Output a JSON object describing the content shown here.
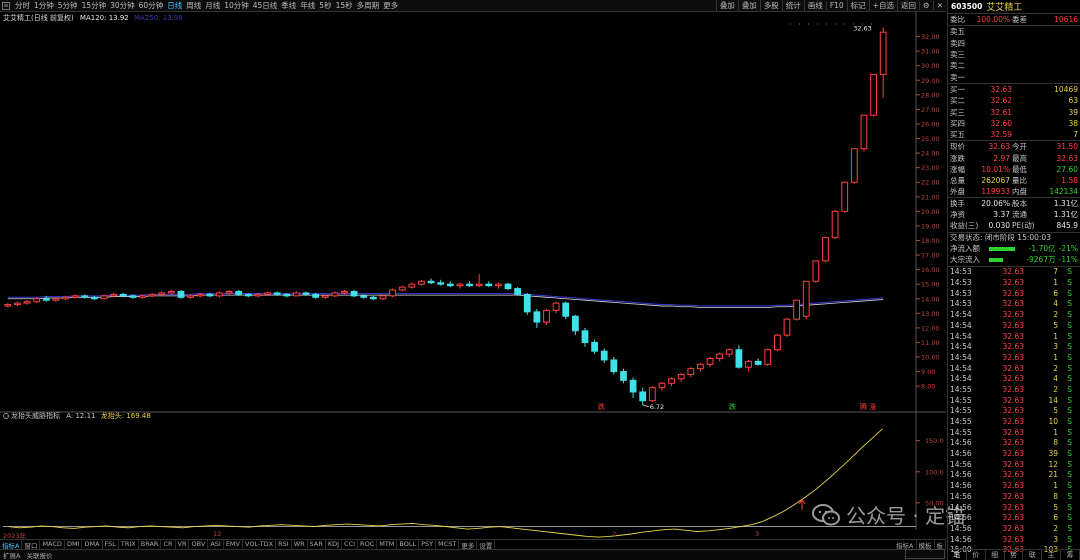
{
  "toolbar": {
    "periods": [
      "分时",
      "1分钟",
      "5分钟",
      "15分钟",
      "30分钟",
      "60分钟",
      "日线",
      "周线",
      "月线",
      "10分钟",
      "45日线",
      "季线",
      "年线",
      "5秒",
      "15秒",
      "多周期",
      "更多"
    ],
    "active_period": "日线",
    "tools": [
      "叠加",
      "叠加",
      "多股",
      "统计",
      "画线",
      "F10",
      "标记",
      "+自选",
      "返回"
    ]
  },
  "chart": {
    "stock_name": "艾艾精工",
    "stock_mode": "(日线 前复权)",
    "ma_label": "MA120: 13.92",
    "ma_dark": "MA250: 13.98",
    "high_label": "32.63",
    "low_label": "6.72",
    "price_ticks": [
      "32.00",
      "31.00",
      "30.00",
      "29.00",
      "28.00",
      "27.00",
      "26.00",
      "25.00",
      "24.00",
      "23.00",
      "22.00",
      "21.00",
      "20.00",
      "19.00",
      "18.00",
      "17.00",
      "16.00",
      "15.00",
      "14.00",
      "13.00",
      "12.00",
      "11.00",
      "10.00",
      "9.00",
      "8.00"
    ],
    "marks": [
      {
        "text": "跌",
        "color": "#ff4040"
      },
      {
        "text": "跌",
        "color": "#2fd22f"
      },
      {
        "text": "腾 涨",
        "color": "#ff4040"
      }
    ]
  },
  "chart_data": {
    "type": "candlestick",
    "ylim": [
      6.5,
      33
    ],
    "ohlc": [
      [
        13.5,
        13.7,
        13.4,
        13.6
      ],
      [
        13.6,
        13.8,
        13.5,
        13.7
      ],
      [
        13.7,
        13.9,
        13.6,
        13.8
      ],
      [
        13.8,
        14.1,
        13.7,
        14.0
      ],
      [
        14.0,
        14.2,
        13.8,
        13.9
      ],
      [
        13.9,
        14.1,
        13.8,
        14.0
      ],
      [
        14.0,
        14.2,
        13.9,
        14.1
      ],
      [
        14.1,
        14.3,
        14.0,
        14.2
      ],
      [
        14.2,
        14.3,
        14.0,
        14.1
      ],
      [
        14.1,
        14.2,
        13.9,
        14.0
      ],
      [
        14.0,
        14.3,
        14.0,
        14.2
      ],
      [
        14.2,
        14.4,
        14.1,
        14.3
      ],
      [
        14.3,
        14.4,
        14.1,
        14.2
      ],
      [
        14.2,
        14.3,
        14.0,
        14.1
      ],
      [
        14.1,
        14.3,
        14.0,
        14.2
      ],
      [
        14.2,
        14.4,
        14.1,
        14.3
      ],
      [
        14.3,
        14.5,
        14.2,
        14.4
      ],
      [
        14.4,
        14.6,
        14.3,
        14.5
      ],
      [
        14.5,
        14.6,
        14.0,
        14.1
      ],
      [
        14.1,
        14.3,
        14.0,
        14.2
      ],
      [
        14.2,
        14.4,
        14.1,
        14.3
      ],
      [
        14.3,
        14.4,
        14.1,
        14.2
      ],
      [
        14.2,
        14.5,
        14.1,
        14.4
      ],
      [
        14.4,
        14.6,
        14.3,
        14.5
      ],
      [
        14.5,
        14.6,
        14.2,
        14.3
      ],
      [
        14.3,
        14.4,
        14.1,
        14.2
      ],
      [
        14.2,
        14.4,
        14.1,
        14.3
      ],
      [
        14.3,
        14.5,
        14.2,
        14.4
      ],
      [
        14.4,
        14.5,
        14.2,
        14.3
      ],
      [
        14.3,
        14.4,
        14.1,
        14.2
      ],
      [
        14.2,
        14.5,
        14.2,
        14.4
      ],
      [
        14.4,
        14.5,
        14.2,
        14.3
      ],
      [
        14.3,
        14.4,
        14.0,
        14.1
      ],
      [
        14.1,
        14.3,
        14.0,
        14.2
      ],
      [
        14.2,
        14.5,
        14.1,
        14.4
      ],
      [
        14.4,
        14.6,
        14.3,
        14.5
      ],
      [
        14.5,
        14.6,
        14.1,
        14.2
      ],
      [
        14.2,
        14.3,
        14.0,
        14.1
      ],
      [
        14.1,
        14.2,
        13.9,
        14.0
      ],
      [
        14.0,
        14.3,
        13.9,
        14.2
      ],
      [
        14.2,
        14.7,
        14.1,
        14.6
      ],
      [
        14.6,
        14.9,
        14.5,
        14.8
      ],
      [
        14.8,
        15.1,
        14.7,
        15.0
      ],
      [
        15.0,
        15.3,
        14.9,
        15.2
      ],
      [
        15.2,
        15.4,
        15.0,
        15.1
      ],
      [
        15.1,
        15.3,
        14.9,
        15.0
      ],
      [
        15.0,
        15.2,
        14.8,
        14.9
      ],
      [
        14.9,
        15.1,
        14.7,
        15.0
      ],
      [
        15.0,
        15.2,
        14.8,
        14.9
      ],
      [
        14.9,
        15.7,
        14.8,
        15.0
      ],
      [
        15.0,
        15.2,
        14.8,
        14.9
      ],
      [
        14.9,
        15.1,
        14.7,
        15.0
      ],
      [
        15.0,
        15.1,
        14.6,
        14.7
      ],
      [
        14.7,
        14.8,
        14.2,
        14.3
      ],
      [
        14.3,
        14.4,
        12.9,
        13.1
      ],
      [
        13.1,
        13.3,
        12.0,
        12.4
      ],
      [
        12.4,
        13.3,
        12.2,
        13.2
      ],
      [
        13.2,
        13.8,
        13.0,
        13.7
      ],
      [
        13.7,
        13.8,
        12.6,
        12.8
      ],
      [
        12.8,
        12.9,
        11.5,
        11.8
      ],
      [
        11.8,
        12.0,
        10.7,
        11.0
      ],
      [
        11.0,
        11.2,
        10.2,
        10.4
      ],
      [
        10.4,
        10.6,
        9.6,
        9.8
      ],
      [
        9.8,
        10.0,
        8.8,
        9.0
      ],
      [
        9.0,
        9.2,
        8.2,
        8.4
      ],
      [
        8.4,
        8.6,
        7.2,
        7.6
      ],
      [
        7.6,
        7.9,
        6.72,
        7.0
      ],
      [
        7.0,
        8.0,
        6.9,
        7.9
      ],
      [
        7.9,
        8.3,
        7.7,
        8.2
      ],
      [
        8.2,
        8.6,
        8.0,
        8.5
      ],
      [
        8.5,
        8.9,
        8.3,
        8.8
      ],
      [
        8.8,
        9.3,
        8.6,
        9.2
      ],
      [
        9.2,
        9.6,
        9.0,
        9.5
      ],
      [
        9.5,
        10.0,
        9.3,
        9.9
      ],
      [
        9.9,
        10.3,
        9.7,
        10.2
      ],
      [
        10.2,
        10.6,
        10.0,
        10.5
      ],
      [
        10.5,
        10.8,
        9.2,
        9.3
      ],
      [
        9.3,
        9.8,
        9.0,
        9.7
      ],
      [
        9.7,
        9.9,
        9.4,
        9.5
      ],
      [
        9.5,
        10.6,
        9.4,
        10.5
      ],
      [
        10.5,
        11.6,
        10.4,
        11.5
      ],
      [
        11.5,
        12.7,
        11.4,
        12.6
      ],
      [
        12.6,
        13.9,
        12.5,
        13.9
      ],
      [
        12.8,
        15.2,
        12.6,
        15.2
      ],
      [
        15.2,
        16.6,
        15.1,
        16.6
      ],
      [
        16.6,
        18.2,
        16.5,
        18.2
      ],
      [
        18.2,
        20.1,
        18.1,
        20.0
      ],
      [
        20.0,
        22.0,
        19.9,
        22.0
      ],
      [
        22.0,
        24.3,
        21.9,
        24.3
      ],
      [
        24.3,
        26.6,
        24.1,
        26.6
      ],
      [
        26.6,
        29.4,
        26.5,
        29.4
      ],
      [
        29.4,
        32.63,
        27.8,
        32.3
      ]
    ],
    "ma": [
      14.0,
      14.0,
      14.0,
      14.0,
      14.05,
      14.05,
      14.05,
      14.1,
      14.1,
      14.1,
      14.1,
      14.15,
      14.15,
      14.15,
      14.15,
      14.2,
      14.2,
      14.2,
      14.2,
      14.2,
      14.25,
      14.25,
      14.25,
      14.25,
      14.25,
      14.25,
      14.25,
      14.25,
      14.25,
      14.25,
      14.25,
      14.25,
      14.25,
      14.25,
      14.25,
      14.25,
      14.25,
      14.25,
      14.25,
      14.25,
      14.25,
      14.25,
      14.25,
      14.25,
      14.25,
      14.25,
      14.25,
      14.25,
      14.25,
      14.25,
      14.25,
      14.25,
      14.25,
      14.25,
      14.2,
      14.15,
      14.1,
      14.05,
      14.0,
      13.95,
      13.9,
      13.85,
      13.8,
      13.75,
      13.7,
      13.65,
      13.6,
      13.55,
      13.5,
      13.5,
      13.45,
      13.45,
      13.4,
      13.4,
      13.4,
      13.4,
      13.4,
      13.4,
      13.4,
      13.4,
      13.45,
      13.45,
      13.5,
      13.55,
      13.6,
      13.65,
      13.7,
      13.75,
      13.8,
      13.85,
      13.9,
      13.95
    ],
    "indicator": {
      "name": "龙抬头威胁指标",
      "a_label": "A: 12.11",
      "b_label": "龙抬头: 169.48",
      "ylim": [
        0,
        180
      ],
      "ticks": [
        "150.0",
        "100.0",
        "50.00"
      ],
      "line": [
        12,
        10,
        11,
        13,
        12,
        10,
        9,
        11,
        12,
        13,
        11,
        10,
        12,
        13,
        12,
        11,
        10,
        12,
        13,
        14,
        13,
        12,
        11,
        13,
        14,
        15,
        14,
        13,
        12,
        14,
        15,
        16,
        15,
        14,
        13,
        15,
        16,
        17,
        15,
        14,
        12,
        10,
        8,
        9,
        11,
        12,
        10,
        8,
        6,
        4,
        2,
        0,
        -2,
        -4,
        -5,
        -4,
        -2,
        0,
        3,
        5,
        7,
        8,
        6,
        4,
        5,
        7,
        9,
        12,
        15,
        20,
        28,
        37,
        48,
        60,
        73,
        88,
        104,
        120,
        137,
        153,
        169
      ]
    }
  },
  "date_axis": [
    "2023年",
    "12",
    "2",
    "3"
  ],
  "tabs": [
    "指标A",
    "窗口",
    "MACD",
    "DMI",
    "DMA",
    "FSL",
    "TRIX",
    "BRAR",
    "CR",
    "VR",
    "OBV",
    "ASI",
    "EMV",
    "VOL-TDX",
    "RSI",
    "WR",
    "SAR",
    "KDJ",
    "CCI",
    "ROC",
    "MTM",
    "BOLL",
    "PSY",
    "MCST",
    "更多",
    "设置"
  ],
  "tabs_right": [
    "指标A",
    "模板",
    "板"
  ],
  "status": [
    "扩展A",
    "关联报价"
  ],
  "panel": {
    "code": "603500",
    "name": "艾艾精工",
    "weibi_label": "委比",
    "weibi": "100.00%",
    "weicha_label": "委差",
    "weicha": "10616",
    "sells": [
      {
        "label": "卖五",
        "price": "",
        "vol": ""
      },
      {
        "label": "卖四",
        "price": "",
        "vol": ""
      },
      {
        "label": "卖三",
        "price": "",
        "vol": ""
      },
      {
        "label": "卖二",
        "price": "",
        "vol": ""
      },
      {
        "label": "卖一",
        "price": "",
        "vol": ""
      }
    ],
    "buys": [
      {
        "label": "买一",
        "price": "32.63",
        "vol": "10469"
      },
      {
        "label": "买二",
        "price": "32.62",
        "vol": "63"
      },
      {
        "label": "买三",
        "price": "32.61",
        "vol": "39"
      },
      {
        "label": "买四",
        "price": "32.60",
        "vol": "38"
      },
      {
        "label": "买五",
        "price": "32.59",
        "vol": "7"
      }
    ],
    "stats": [
      {
        "a": "现价",
        "b": "32.63",
        "bc": "red",
        "c": "今开",
        "d": "31.50",
        "dc": "red"
      },
      {
        "a": "涨跌",
        "b": "2.97",
        "bc": "red",
        "c": "最高",
        "d": "32.63",
        "dc": "red"
      },
      {
        "a": "涨幅",
        "b": "10.01%",
        "bc": "red",
        "c": "最低",
        "d": "27.60",
        "dc": "green"
      },
      {
        "a": "总量",
        "b": "262067",
        "bc": "yellow",
        "c": "量比",
        "d": "1.58",
        "dc": "red"
      },
      {
        "a": "外盘",
        "b": "119933",
        "bc": "red",
        "c": "内盘",
        "d": "142134",
        "dc": "green"
      },
      {
        "a": "换手",
        "b": "20.06%",
        "bc": "white",
        "c": "股本",
        "d": "1.31亿",
        "dc": "white"
      },
      {
        "a": "净资",
        "b": "3.37",
        "bc": "white",
        "c": "流通",
        "d": "1.31亿",
        "dc": "white"
      },
      {
        "a": "收益(三)",
        "b": "0.030",
        "bc": "white",
        "c": "PE(动)",
        "d": "845.9",
        "dc": "white"
      }
    ],
    "trade_status": "交易状态: 闭市阶段 15:00:03",
    "flow": [
      {
        "label": "净流入额",
        "value": "-1.70亿",
        "pct": "-21%"
      },
      {
        "label": "大宗流入",
        "value": "-9267万",
        "pct": "-11%"
      }
    ],
    "ticks": [
      {
        "t": "14:53",
        "p": "32.63",
        "v": "7",
        "s": "S"
      },
      {
        "t": "14:53",
        "p": "32.63",
        "v": "1",
        "s": "S"
      },
      {
        "t": "14:53",
        "p": "32.63",
        "v": "6",
        "s": "S"
      },
      {
        "t": "14:53",
        "p": "32.63",
        "v": "4",
        "s": "S"
      },
      {
        "t": "14:54",
        "p": "32.63",
        "v": "2",
        "s": "S"
      },
      {
        "t": "14:54",
        "p": "32.63",
        "v": "5",
        "s": "S"
      },
      {
        "t": "14:54",
        "p": "32.63",
        "v": "1",
        "s": "S"
      },
      {
        "t": "14:54",
        "p": "32.63",
        "v": "3",
        "s": "S"
      },
      {
        "t": "14:54",
        "p": "32.63",
        "v": "1",
        "s": "S"
      },
      {
        "t": "14:54",
        "p": "32.63",
        "v": "2",
        "s": "S"
      },
      {
        "t": "14:54",
        "p": "32.63",
        "v": "4",
        "s": "S"
      },
      {
        "t": "14:55",
        "p": "32.63",
        "v": "2",
        "s": "S"
      },
      {
        "t": "14:55",
        "p": "32.63",
        "v": "14",
        "s": "S"
      },
      {
        "t": "14:55",
        "p": "32.63",
        "v": "5",
        "s": "S"
      },
      {
        "t": "14:55",
        "p": "32.63",
        "v": "10",
        "s": "S"
      },
      {
        "t": "14:55",
        "p": "32.63",
        "v": "1",
        "s": "S"
      },
      {
        "t": "14:56",
        "p": "32.63",
        "v": "8",
        "s": "S"
      },
      {
        "t": "14:56",
        "p": "32.63",
        "v": "39",
        "s": "S"
      },
      {
        "t": "14:56",
        "p": "32.63",
        "v": "12",
        "s": "S"
      },
      {
        "t": "14:56",
        "p": "32.63",
        "v": "21",
        "s": "S"
      },
      {
        "t": "14:56",
        "p": "32.63",
        "v": "1",
        "s": "S"
      },
      {
        "t": "14:56",
        "p": "32.63",
        "v": "8",
        "s": "S"
      },
      {
        "t": "14:56",
        "p": "32.63",
        "v": "5",
        "s": "S"
      },
      {
        "t": "14:56",
        "p": "32.63",
        "v": "6",
        "s": "S"
      },
      {
        "t": "14:56",
        "p": "32.63",
        "v": "2",
        "s": "S"
      },
      {
        "t": "14:56",
        "p": "32.63",
        "v": "3",
        "s": "S"
      },
      {
        "t": "15:00",
        "p": "32.63",
        "v": "103",
        "s": "S"
      }
    ],
    "footer": [
      "笔",
      "价",
      "细",
      "势",
      "联",
      "主",
      "筹"
    ]
  },
  "watermark": {
    "text": "公众号 · 定锚",
    "icon": "wechat-icon"
  }
}
